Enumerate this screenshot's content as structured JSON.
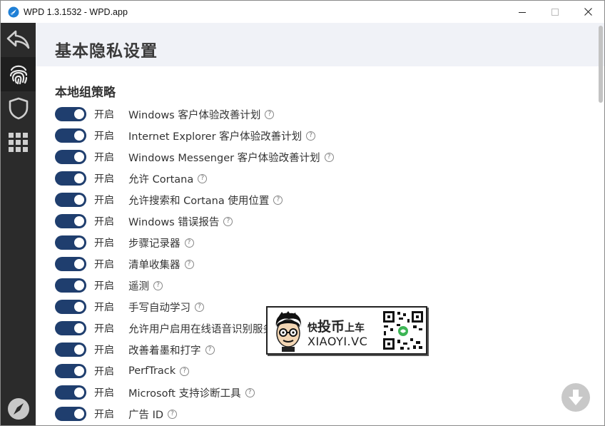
{
  "window": {
    "title": "WPD 1.3.1532 - WPD.app"
  },
  "sidebar": {
    "items": [
      {
        "icon": "back-arrow-icon"
      },
      {
        "icon": "fingerprint-icon",
        "active": true
      },
      {
        "icon": "shield-icon"
      },
      {
        "icon": "apps-grid-icon"
      },
      {
        "icon": "compass-icon"
      }
    ]
  },
  "page": {
    "title": "基本隐私设置",
    "section_title": "本地组策略"
  },
  "settings": [
    {
      "state": "开启",
      "label": "Windows 客户体验改善计划",
      "help": "?"
    },
    {
      "state": "开启",
      "label": "Internet Explorer 客户体验改善计划",
      "help": "?"
    },
    {
      "state": "开启",
      "label": "Windows Messenger 客户体验改善计划",
      "help": "?"
    },
    {
      "state": "开启",
      "label": "允许 Cortana",
      "help": "?"
    },
    {
      "state": "开启",
      "label": "允许搜索和 Cortana 使用位置",
      "help": "?"
    },
    {
      "state": "开启",
      "label": "Windows 错误报告",
      "help": "?"
    },
    {
      "state": "开启",
      "label": "步骤记录器",
      "help": "?"
    },
    {
      "state": "开启",
      "label": "清单收集器",
      "help": "?"
    },
    {
      "state": "开启",
      "label": "遥测",
      "help": "?"
    },
    {
      "state": "开启",
      "label": "手写自动学习",
      "help": "?"
    },
    {
      "state": "开启",
      "label": "允许用户启用在线语音识别服务",
      "help": "?"
    },
    {
      "state": "开启",
      "label": "改善着墨和打字",
      "help": "?"
    },
    {
      "state": "开启",
      "label": "PerfTrack",
      "help": "?"
    },
    {
      "state": "开启",
      "label": "Microsoft 支持诊断工具",
      "help": "?"
    },
    {
      "state": "开启",
      "label": "广告 ID",
      "help": "?"
    }
  ],
  "watermark": {
    "line1_prefix": "快",
    "line1_big": "投币",
    "line1_suffix": "上车",
    "line2": "XIAOYI.VC"
  },
  "colors": {
    "toggle_on": "#1f3e6e",
    "sidebar_bg": "#2b2b2b",
    "header_band": "#f0f2f7"
  }
}
